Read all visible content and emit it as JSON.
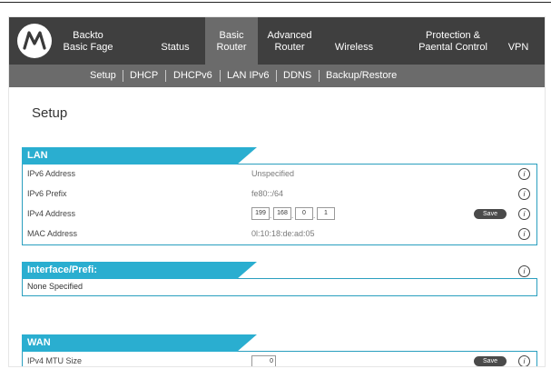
{
  "nav": {
    "back": [
      "Backto",
      "Basic Fage"
    ],
    "status": "Status",
    "basic_router": [
      "Basic",
      "Router"
    ],
    "advanced_router": [
      "Advanced",
      "Router"
    ],
    "wireless": "Wireless",
    "protection": [
      "Protection &",
      "Paental Control"
    ],
    "vpn": "VPN"
  },
  "subnav": [
    "Setup",
    "DHCP",
    "DHCPv6",
    "LAN IPv6",
    "DDNS",
    "Backup/Restore"
  ],
  "page_title": "Setup",
  "lan": {
    "title": "LAN",
    "rows": [
      {
        "label": "IPv6 Address",
        "value": "Unspecified"
      },
      {
        "label": "IPv6 Prefix",
        "value": "fe80::/64"
      },
      {
        "label": "IPv4 Address",
        "octets": [
          "199",
          "168",
          "0",
          "1"
        ],
        "save": "Save"
      },
      {
        "label": "MAC Address",
        "value": "0l:10:18:de:ad:05"
      }
    ]
  },
  "iface": {
    "title": "Interface/Prefi:",
    "row": "None Specified"
  },
  "wan": {
    "title": "WAN",
    "mtu_label": "IPv4 MTU Size",
    "mtu_value": "0",
    "save": "Save"
  },
  "info_glyph": "i",
  "colors": {
    "accent": "#2aaed0",
    "nav_bg": "#3f3f3f",
    "subnav_bg": "#6b6b6b"
  }
}
